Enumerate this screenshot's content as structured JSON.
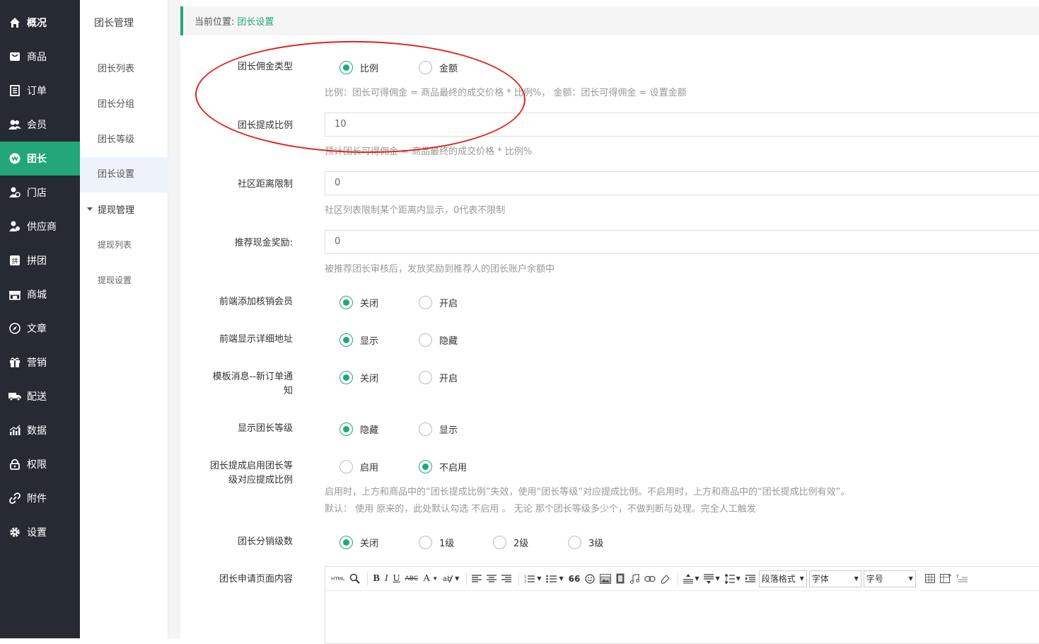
{
  "nav": [
    {
      "label": "概况",
      "icon": "home-icon"
    },
    {
      "label": "商品",
      "icon": "goods-icon"
    },
    {
      "label": "订单",
      "icon": "order-icon"
    },
    {
      "label": "会员",
      "icon": "member-icon"
    },
    {
      "label": "团长",
      "icon": "leader-icon",
      "active": true
    },
    {
      "label": "门店",
      "icon": "store-icon"
    },
    {
      "label": "供应商",
      "icon": "supplier-icon"
    },
    {
      "label": "拼团",
      "icon": "groupbuy-icon"
    },
    {
      "label": "商城",
      "icon": "mall-icon"
    },
    {
      "label": "文章",
      "icon": "article-icon"
    },
    {
      "label": "营销",
      "icon": "gift-icon"
    },
    {
      "label": "配送",
      "icon": "truck-icon"
    },
    {
      "label": "数据",
      "icon": "chart-icon"
    },
    {
      "label": "权限",
      "icon": "lock-icon"
    },
    {
      "label": "附件",
      "icon": "link-icon"
    },
    {
      "label": "设置",
      "icon": "gear-icon"
    }
  ],
  "subnav": {
    "title": "团长管理",
    "items": [
      "团长列表",
      "团长分组",
      "团长等级",
      "团长设置"
    ],
    "group": "提现管理",
    "group_items": [
      "提现列表",
      "提现设置"
    ]
  },
  "breadcrumb": {
    "prefix": "当前位置:",
    "current": "团长设置"
  },
  "form": {
    "commission_type": {
      "label": "团长佣金类型",
      "options": [
        "比例",
        "金额"
      ],
      "selected": 0,
      "hint": "比例：团长可得佣金 = 商品最终的成交价格 * 比例%，  金额：团长可得佣金 = 设置金额"
    },
    "commission_rate": {
      "label": "团长提成比例",
      "value": "10",
      "hint": "预计团长可得佣金 = 商品最终的成交价格 * 比例%"
    },
    "distance_limit": {
      "label": "社区距离限制",
      "value": "0",
      "hint": "社区列表限制某个距离内显示，0代表不限制"
    },
    "referral_reward": {
      "label": "推荐现金奖励:",
      "value": "0",
      "hint": "被推荐团长审核后，发放奖励到推荐人的团长账户余额中"
    },
    "frontend_verify": {
      "label": "前端添加核销会员",
      "options": [
        "关闭",
        "开启"
      ],
      "selected": 0
    },
    "frontend_address": {
      "label": "前端显示详细地址",
      "options": [
        "显示",
        "隐藏"
      ],
      "selected": 0
    },
    "template_msg": {
      "label_line1": "模板消息--新订单通",
      "label_line2": "知",
      "options": [
        "关闭",
        "开启"
      ],
      "selected": 0
    },
    "show_level": {
      "label": "显示团长等级",
      "options": [
        "隐藏",
        "显示"
      ],
      "selected": 0
    },
    "level_rate": {
      "label_line1": "团长提成启用团长等",
      "label_line2": "级对应提成比例",
      "options": [
        "启用",
        "不启用"
      ],
      "selected": 1,
      "hint1": "启用时，上方和商品中的“团长提成比例”失效，使用“团长等级”对应提成比例。不启用时，上方和商品中的“团长提成比例有效”。",
      "hint2": "默认： 使用 原来的，此处默认勾选 不启用 。 无论 那个团长等级多少个，不做判断与处理。完全人工触发"
    },
    "distribution_level": {
      "label": "团长分销级数",
      "options": [
        "关闭",
        "1级",
        "2级",
        "3级"
      ],
      "selected": 0
    },
    "apply_content": {
      "label": "团长申请页面内容"
    }
  },
  "editor": {
    "html_label": "HTML",
    "paragraph_label": "段落格式",
    "font_label": "字体",
    "size_label": "字号",
    "buttons": [
      "search-icon",
      "bold-icon",
      "italic-icon",
      "underline-icon",
      "strikethrough-icon",
      "font-color-icon",
      "highlight-icon",
      "align-left-icon",
      "align-center-icon",
      "align-right-icon",
      "ordered-list-icon",
      "unordered-list-icon",
      "quote-icon",
      "emoji-icon",
      "image-icon",
      "video-icon",
      "music-icon",
      "link-icon",
      "eraser-icon"
    ],
    "bold": "B",
    "italic": "I",
    "underline": "U",
    "strike": "ABC",
    "fontcolor": "A",
    "quote": "66"
  },
  "colors": {
    "accent": "#22a67a",
    "nav_bg": "#262a33",
    "annotation": "#e0231b"
  }
}
